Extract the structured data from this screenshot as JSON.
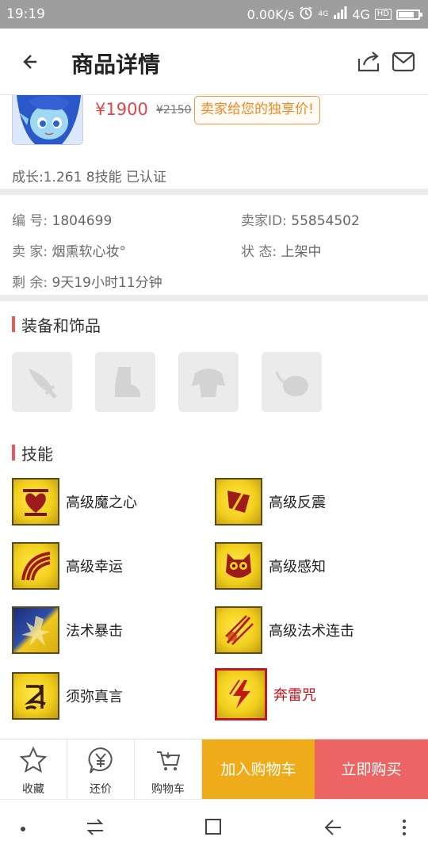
{
  "status_bar": {
    "time": "19:19",
    "speed": "0.00K/s",
    "network": "4G",
    "hd": "HD",
    "small_4g": "4G",
    "battery_level": 0.8
  },
  "header": {
    "title": "商品详情"
  },
  "product": {
    "price": "¥1900",
    "original_price": "¥2150",
    "exclusive_label": "卖家给您的独享价!",
    "growth_text": "成长:1.261 8技能 已认证"
  },
  "info": {
    "number_label": "编  号:",
    "number_value": "1804699",
    "seller_id_label": "卖家ID:",
    "seller_id_value": "55854502",
    "seller_label": "卖  家:",
    "seller_value": "烟熏软心妆°",
    "status_label": "状  态:",
    "status_value": "上架中",
    "remaining_label": "剩  余:",
    "remaining_value": "9天19小时11分钟"
  },
  "equipment": {
    "title": "装备和饰品",
    "slots": [
      "weapon-icon",
      "boots-icon",
      "armor-icon",
      "accessory-icon"
    ]
  },
  "skills": {
    "title": "技能",
    "items": [
      {
        "name": "高级魔之心",
        "icon": "heart-emblem-icon"
      },
      {
        "name": "高级反震",
        "icon": "shield-icon"
      },
      {
        "name": "高级幸运",
        "icon": "rainbow-icon"
      },
      {
        "name": "高级感知",
        "icon": "owl-icon"
      },
      {
        "name": "法术暴击",
        "icon": "burst-icon"
      },
      {
        "name": "高级法术连击",
        "icon": "claw-slash-icon"
      },
      {
        "name": "须弥真言",
        "icon": "rune-icon"
      },
      {
        "name": "奔雷咒",
        "icon": "lightning-icon"
      }
    ]
  },
  "bottom_bar": {
    "favorite": "收藏",
    "bargain": "还价",
    "cart": "购物车",
    "add_to_cart": "加入购物车",
    "buy_now": "立即购买"
  },
  "colors": {
    "accent_red": "#e2464a",
    "orange": "#efac1a",
    "buy_red": "#ec6464",
    "exclusive_orange": "#ef8a26"
  }
}
